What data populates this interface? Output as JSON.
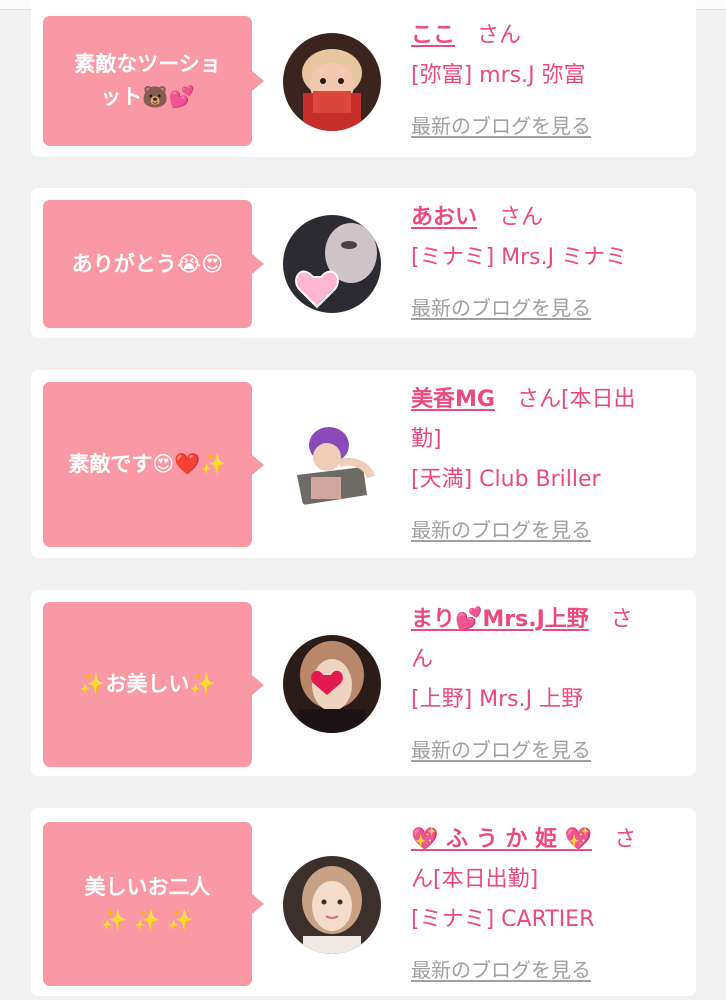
{
  "comments": [
    {
      "message_lines": [
        "素敵なツーショ",
        "ット🐻💕"
      ],
      "name": "ここ",
      "line1_suffix": "さん",
      "line2": "",
      "shop": "[弥富] mrs.J 弥富",
      "blog_link": "最新のブログを見る"
    },
    {
      "message_lines": [
        "ありがとう😭😍"
      ],
      "name": "あおい",
      "line1_suffix": "さん",
      "line2": "",
      "shop": "[ミナミ] Mrs.J ミナミ",
      "blog_link": "最新のブログを見る"
    },
    {
      "message_lines": [
        "素敵です😍❤️✨"
      ],
      "name": "美香MG",
      "line1_suffix": "さん[本日出",
      "line2": "勤]",
      "shop": "[天満] Club Briller",
      "blog_link": "最新のブログを見る"
    },
    {
      "message_lines": [
        "✨お美しい✨"
      ],
      "name": "まり💕Mrs.J上野",
      "line1_suffix": "さ",
      "line2": "ん",
      "shop": "[上野] Mrs.J 上野",
      "blog_link": "最新のブログを見る"
    },
    {
      "message_lines": [
        "美しいお二人",
        "✨ ✨ ✨"
      ],
      "name": "💖 ふ う か 姫 💖",
      "line1_suffix": "さ",
      "line2": "ん[本日出勤]",
      "shop": "[ミナミ] CARTIER",
      "blog_link": "最新のブログを見る"
    }
  ],
  "colors": {
    "bubble": "#fa98a6",
    "accent_pink": "#ec4a7e",
    "link_gray": "#a0a0a0",
    "page_bg": "#f1f1f1"
  }
}
